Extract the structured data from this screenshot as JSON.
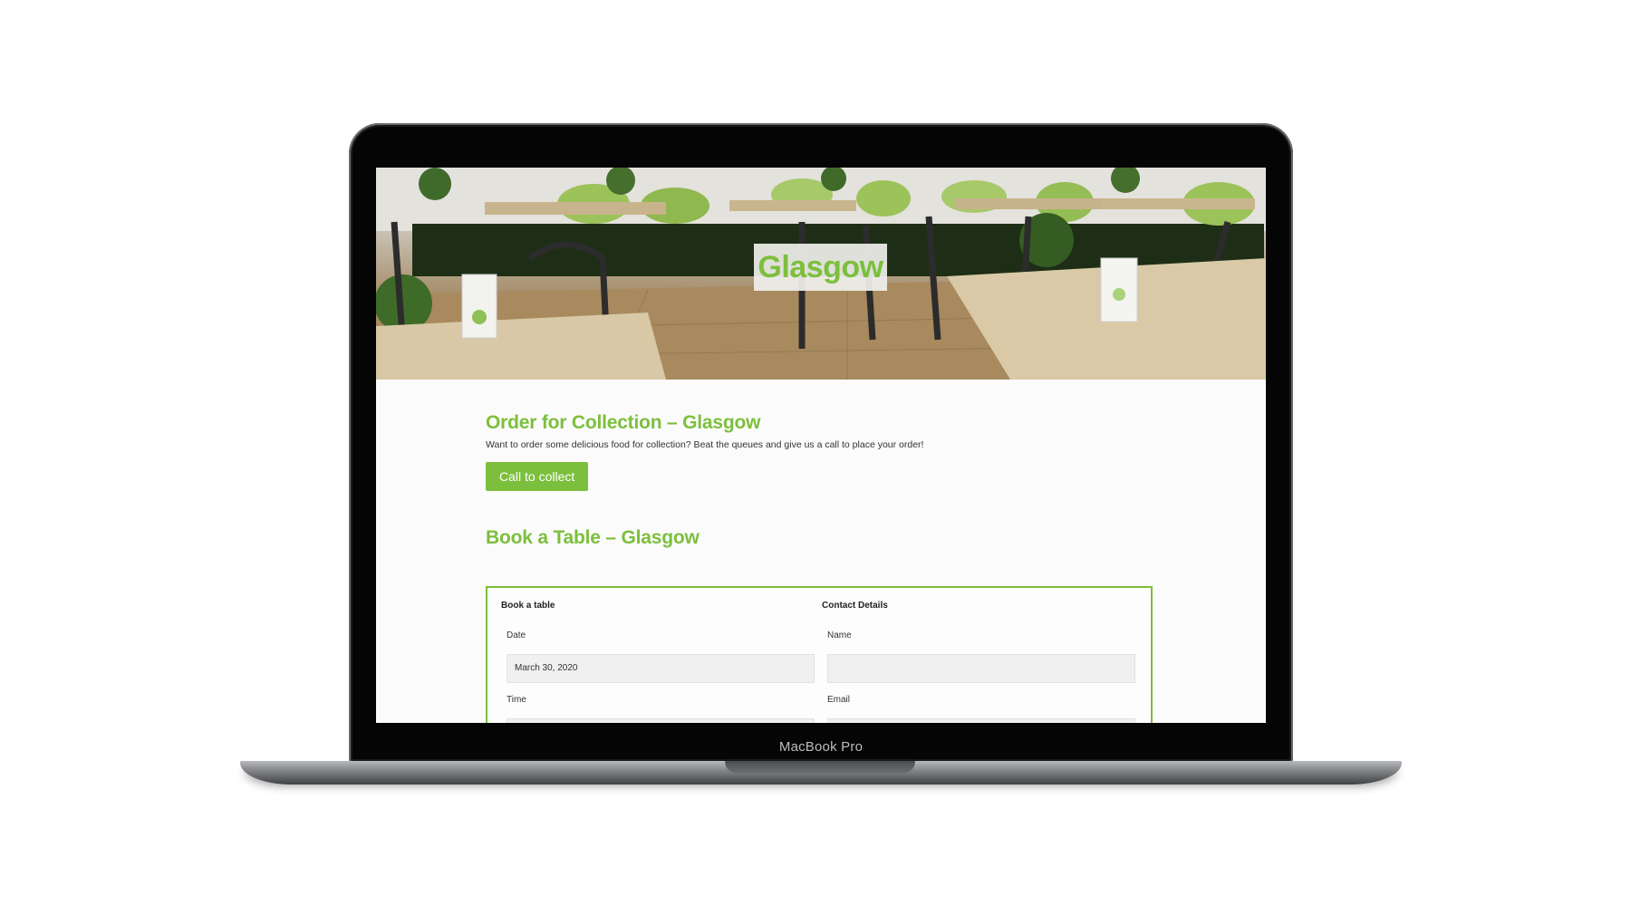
{
  "device": {
    "label": "MacBook Pro"
  },
  "hero": {
    "title": "Glasgow"
  },
  "collection": {
    "heading": "Order for Collection – Glasgow",
    "intro": "Want to order some delicious food for collection? Beat the queues and give us a call to place your order!",
    "button_label": "Call to collect"
  },
  "booking": {
    "heading": "Book a Table – Glasgow",
    "left_column_title": "Book a table",
    "right_column_title": "Contact Details",
    "date_label": "Date",
    "date_value": "March 30, 2020",
    "time_label": "Time",
    "time_value": "",
    "name_label": "Name",
    "name_value": "",
    "email_label": "Email",
    "email_value": ""
  },
  "colors": {
    "accent": "#7cbf3d",
    "laptop_bezel": "#050505",
    "input_bg": "#f0f0f0"
  }
}
